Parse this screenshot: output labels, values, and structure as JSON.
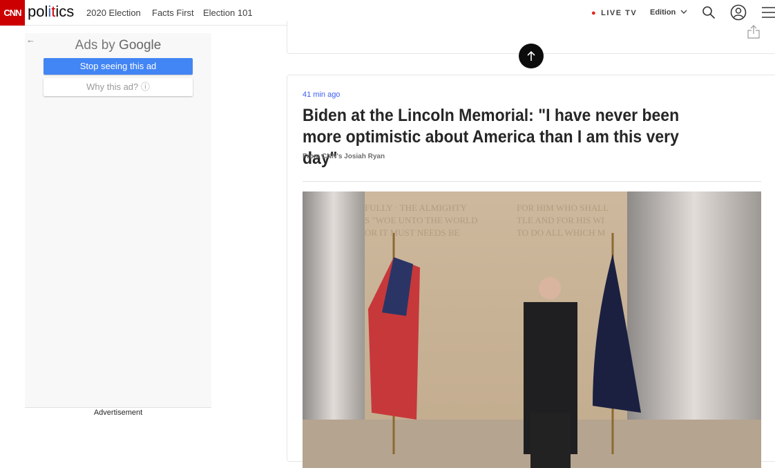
{
  "header": {
    "logo": "CNN",
    "section_pre": "pol",
    "section_i": "i",
    "section_t": "t",
    "section_post": "ics",
    "nav": [
      "2020 Election",
      "Facts First",
      "Election 101"
    ],
    "live_tv": "LIVE TV",
    "edition": "Edition",
    "icons": [
      "search-icon",
      "user-icon",
      "menu-icon"
    ]
  },
  "ad": {
    "title_pre": "Ads by ",
    "title_brand": "Google",
    "stop": "Stop seeing this ad",
    "why": "Why this ad? ⓘ",
    "label": "Advertisement"
  },
  "post": {
    "time": "41 min ago",
    "title": "Biden at the Lincoln Memorial: \"I have never been more optimistic about America than I am this very day\"",
    "byline": "From CNN's Josiah Ryan"
  },
  "colors": {
    "brand": "#cc0000",
    "live_dot": "#e2231a",
    "time": "#3b5cf0",
    "ad_button": "#4285f4"
  }
}
